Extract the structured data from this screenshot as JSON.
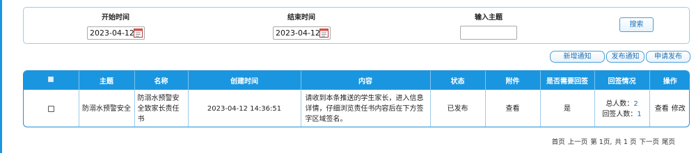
{
  "search": {
    "start_label": "开始时间",
    "start_value": "2023-04-12",
    "end_label": "结束时间",
    "end_value": "2023-04-12",
    "topic_label": "输入主题",
    "topic_value": "",
    "search_button": "搜索"
  },
  "actions": {
    "new_notice": "新增通知",
    "publish_notice": "发布通知",
    "apply_publish": "申请发布"
  },
  "table": {
    "headers": [
      "主题",
      "名称",
      "创建时间",
      "内容",
      "状态",
      "附件",
      "是否需要回签",
      "回签情况",
      "操作"
    ],
    "rows": [
      {
        "topic": "防溺水预警安全",
        "name": "防溺水预警安全致家长责任书",
        "created": "2023-04-12 14:36:51",
        "content": "请收到本条推送的学生家长，进入信息详情，仔细浏览责任书内容后在下方签字区域签名。",
        "status": "已发布",
        "attachment": "查看",
        "need_sign": "是",
        "total_label": "总人数：",
        "total": "2",
        "signed_label": "回签人数：",
        "signed": "1",
        "op_view": "查看",
        "op_edit": "修改"
      }
    ]
  },
  "pager": {
    "first": "首页",
    "prev": "上一页",
    "current": "第 1页,",
    "total": "共 1 页",
    "next": "下一页",
    "last": "尾页"
  },
  "colors": {
    "header_bg": "#1a96e0",
    "accent": "#1a6fb5"
  }
}
